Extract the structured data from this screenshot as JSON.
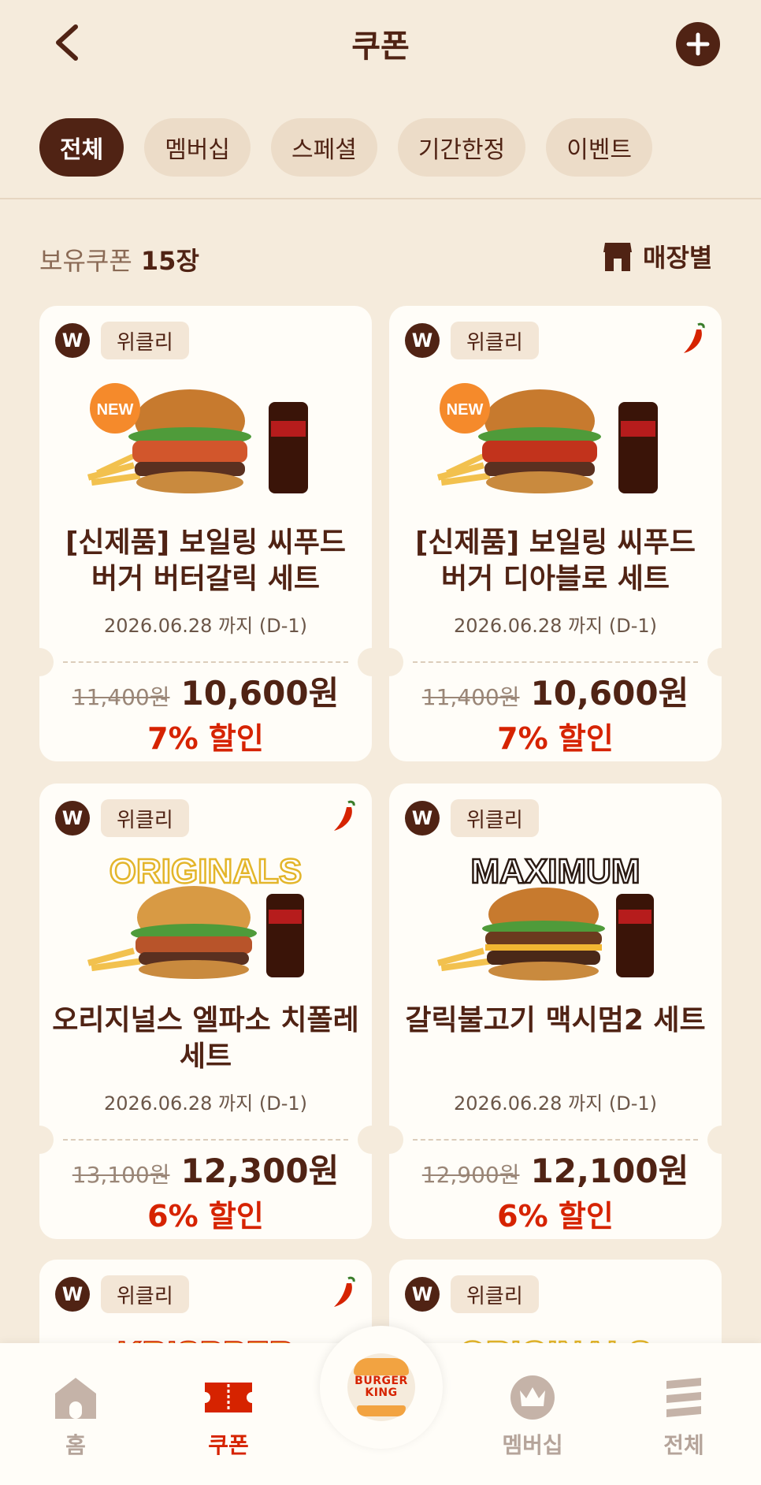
{
  "header": {
    "title": "쿠폰"
  },
  "tabs": [
    {
      "label": "전체",
      "active": true
    },
    {
      "label": "멤버십",
      "active": false
    },
    {
      "label": "스페셜",
      "active": false
    },
    {
      "label": "기간한정",
      "active": false
    },
    {
      "label": "이벤트",
      "active": false
    }
  ],
  "coupon_count": {
    "label": "보유쿠폰",
    "value": "15장"
  },
  "store_button": {
    "label": "매장별"
  },
  "coupons": [
    {
      "badge": "W",
      "tag": "위클리",
      "spicy": false,
      "new_badge": "NEW",
      "title": "[신제품] 보일링 씨푸드 버거 버터갈릭 세트",
      "expiry": "2026.06.28 까지  (D-1)",
      "original_price": "11,400원",
      "sale_price": "10,600원",
      "discount": "7% 할인"
    },
    {
      "badge": "W",
      "tag": "위클리",
      "spicy": true,
      "new_badge": "NEW",
      "title": "[신제품] 보일링 씨푸드 버거 디아블로 세트",
      "expiry": "2026.06.28 까지  (D-1)",
      "original_price": "11,400원",
      "sale_price": "10,600원",
      "discount": "7% 할인"
    },
    {
      "badge": "W",
      "tag": "위클리",
      "spicy": true,
      "backdrop_text": "ORIGINALS",
      "title": "오리지널스 엘파소 치폴레 세트",
      "expiry": "2026.06.28 까지  (D-1)",
      "original_price": "13,100원",
      "sale_price": "12,300원",
      "discount": "6% 할인"
    },
    {
      "badge": "W",
      "tag": "위클리",
      "spicy": false,
      "backdrop_text": "MAXIMUM",
      "title": "갈릭불고기 맥시멈2 세트",
      "expiry": "2026.06.28 까지  (D-1)",
      "original_price": "12,900원",
      "sale_price": "12,100원",
      "discount": "6% 할인"
    },
    {
      "badge": "W",
      "tag": "위클리",
      "spicy": true,
      "backdrop_text": "KRISPPER"
    },
    {
      "badge": "W",
      "tag": "위클리",
      "spicy": false,
      "backdrop_text": "ORIGINALS"
    }
  ],
  "bottom_nav": {
    "items": [
      {
        "label": "홈",
        "icon": "home-icon",
        "active": false
      },
      {
        "label": "쿠폰",
        "icon": "coupon-icon",
        "active": true
      },
      {
        "label": "멤버십",
        "icon": "crown-icon",
        "active": false
      },
      {
        "label": "전체",
        "icon": "menu-icon",
        "active": false
      }
    ],
    "center_logo": "BURGER KING"
  },
  "colors": {
    "background": "#f5ebdc",
    "brown": "#502314",
    "red": "#d62300",
    "card": "#fffdf8"
  }
}
